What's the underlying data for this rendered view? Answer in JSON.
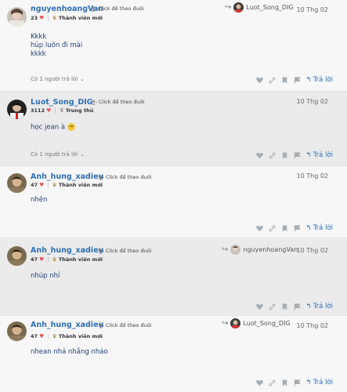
{
  "follow_label": "Click để theo đuôi",
  "reply_label": "Trả lời",
  "posts": [
    {
      "username": "nguyenhoangVan",
      "score": "23",
      "rank": "Thành viên mới",
      "reply_to": "Luot_Song_DIG",
      "date": "10 Thg 02",
      "body": [
        "Kkkk",
        "húp luôn đi mài",
        "kkkk"
      ],
      "replies": "Có 1 người trả lời"
    },
    {
      "username": "Luot_Song_DIG",
      "score": "3112",
      "rank": "Trung thủ",
      "date": "10 Thg 02",
      "body": [
        "học jean à"
      ],
      "replies": "Có 1 người trả lời"
    },
    {
      "username": "Anh_hung_xadieu",
      "score": "47",
      "rank": "Thành viên mới",
      "date": "10 Thg 02",
      "body": [
        "nhên"
      ]
    },
    {
      "username": "Anh_hung_xadieu",
      "score": "47",
      "rank": "Thành viên mới",
      "reply_to": "nguyenhoangVan",
      "date": "10 Thg 02",
      "body": [
        "nhúp nhỉ"
      ]
    },
    {
      "username": "Anh_hung_xadieu",
      "score": "47",
      "rank": "Thành viên mới",
      "reply_to": "Luot_Song_DIG",
      "date": "10 Thg 02",
      "body": [
        "nhean nhả nhẳng nhảo"
      ]
    }
  ]
}
